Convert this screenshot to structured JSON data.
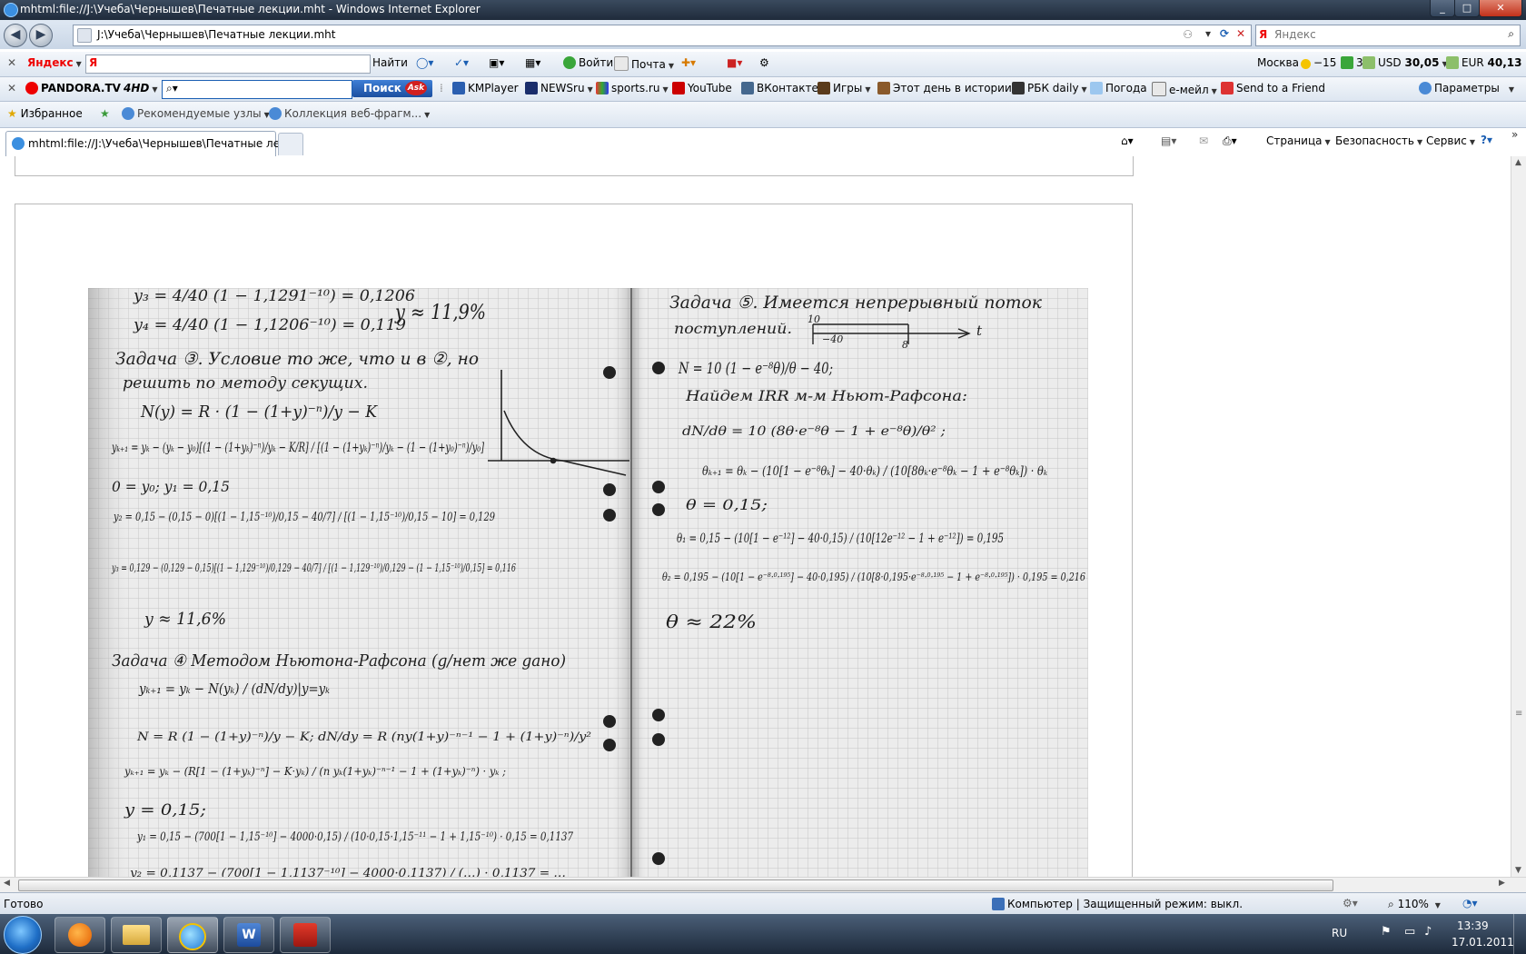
{
  "window": {
    "title": "mhtml:file://J:\\Учеба\\Чернышев\\Печатные лекции.mht - Windows Internet Explorer",
    "btn_min": "_",
    "btn_max": "□",
    "btn_close": "✕"
  },
  "address_bar": {
    "url": "J:\\Учеба\\Чернышев\\Печатные лекции.mht",
    "back_arrow": "◀",
    "forward_arrow": "▶",
    "search_placeholder": "Яндекс"
  },
  "yandex_toolbar": {
    "brand": "Яндекс",
    "logo": "Я",
    "find_button": "Найти",
    "login": "Войти",
    "mail": "Почта",
    "city": "Москва",
    "temperature": "−15",
    "traffic": "3",
    "usd_label": "USD",
    "usd_value": "30,05",
    "eur_label": "EUR",
    "eur_value": "40,13"
  },
  "pandora_toolbar": {
    "brand": "PANDORA.TV",
    "brand_suffix": "4HD",
    "search_button": "Поиск",
    "ask": "Ask",
    "links": [
      "KMPlayer",
      "NEWSru",
      "sports.ru",
      "YouTube",
      "ВКонтакте",
      "Игры",
      "Этот день в истории",
      "РБК daily",
      "Погода",
      "е-мейл",
      "Send to a Friend"
    ],
    "params": "Параметры"
  },
  "favorites_bar": {
    "favorites": "Избранное",
    "recommended": "Рекомендуемые узлы",
    "webslices": "Коллекция веб-фрагм..."
  },
  "tab": {
    "label": "mhtml:file://J:\\Учеба\\Чернышев\\Печатные лек..."
  },
  "command_bar": {
    "page": "Страница",
    "security": "Безопасность",
    "tools": "Сервис"
  },
  "status_bar": {
    "status": "Готово",
    "zone": "Компьютер | Защищенный режим: выкл.",
    "zoom": "110%"
  },
  "taskbar": {
    "lang": "RU",
    "time": "13:39",
    "date": "17.01.2011"
  },
  "notes": {
    "left": [
      "y₃ = 4/40 (1 − 1,1291⁻¹⁰) = 0,1206",
      "y₄ = 4/40 (1 − 1,1206⁻¹⁰) = 0,119",
      "y ≈ 11,9%",
      "Задача ③. Условие то же, что и в ②, но",
      "решить по методу секущих.",
      "N(y) = R · (1 − (1+y)⁻ⁿ)/y − K",
      "yₖ₊₁ = yₖ − (yₖ − y₀)[(1 − (1+yₖ)⁻ⁿ)/yₖ − K/R] / [(1 − (1+yₖ)⁻ⁿ)/yₖ − (1 − (1+y₀)⁻ⁿ)/y₀]",
      "0 = y₀; y₁ = 0,15",
      "y₂ = 0,15 − (0,15 − 0)[(1 − 1,15⁻¹⁰)/0,15 − 40/7] / [(1 − 1,15⁻¹⁰)/0,15 − 10] = 0,129",
      "y₃ = 0,129 − (0,129 − 0,15)[(1 − 1,129⁻¹⁰)/0,129 − 40/7] / [(1 − 1,129⁻¹⁰)/0,129 − (1 − 1,15⁻¹⁰)/0,15] = 0,116",
      "y ≈ 11,6%",
      "Задача ④ Методом Ньютона-Рафсона (g/нет же gано)",
      "yₖ₊₁ = yₖ − N(yₖ) / (dN/dy)|y=yₖ",
      "N = R (1 − (1+y)⁻ⁿ)/y − K;   dN/dy = R (ny(1+y)⁻ⁿ⁻¹ − 1 + (1+y)⁻ⁿ)/y²",
      "yₖ₊₁ = yₖ − (R[1 − (1+yₖ)⁻ⁿ] − K·yₖ) / (n yₖ(1+yₖ)⁻ⁿ⁻¹ − 1 + (1+yₖ)⁻ⁿ) · yₖ ;",
      "y = 0,15;",
      "y₁ = 0,15 − (700[1 − 1,15⁻¹⁰] − 4000·0,15) / (10·0,15·1,15⁻¹¹ − 1 + 1,15⁻¹⁰) · 0,15 = 0,1137",
      "y₂ = 0,1137 − (700[1 − 1,1137⁻¹⁰] − 4000·0,1137) / (…) · 0,1137 = …"
    ],
    "right": [
      "Задача ⑤. Имеется непрерывный поток",
      "поступлений.",
      "10",
      "−40",
      "8",
      "t",
      "N = 10 (1 − e⁻⁸θ)/θ − 40;",
      "Найдем IRR м-м Ньют-Рафсона:",
      "dN/dθ = 10 (8θ·e⁻⁸θ − 1 + e⁻⁸θ)/θ² ;",
      "θₖ₊₁ = θₖ − (10[1 − e⁻⁸θₖ] − 40·θₖ) / (10[8θₖ·e⁻⁸θₖ − 1 + e⁻⁸θₖ]) · θₖ",
      "θ = 0,15;",
      "θ₁ = 0,15 − (10[1 − e⁻¹²] − 40·0,15) / (10[12e⁻¹² − 1 + e⁻¹²]) = 0,195",
      "θ₂ = 0,195 − (10[1 − e⁻⁸·⁰·¹⁹⁵] − 40·0,195) / (10[8·0,195·e⁻⁸·⁰·¹⁹⁵ − 1 + e⁻⁸·⁰·¹⁹⁵]) · 0,195 = 0,216",
      "θ ≈ 22%"
    ]
  },
  "colors": {
    "accent": "#1b5fb3",
    "title_bar": "#2b394b",
    "taskbar": "#2d3d52"
  }
}
